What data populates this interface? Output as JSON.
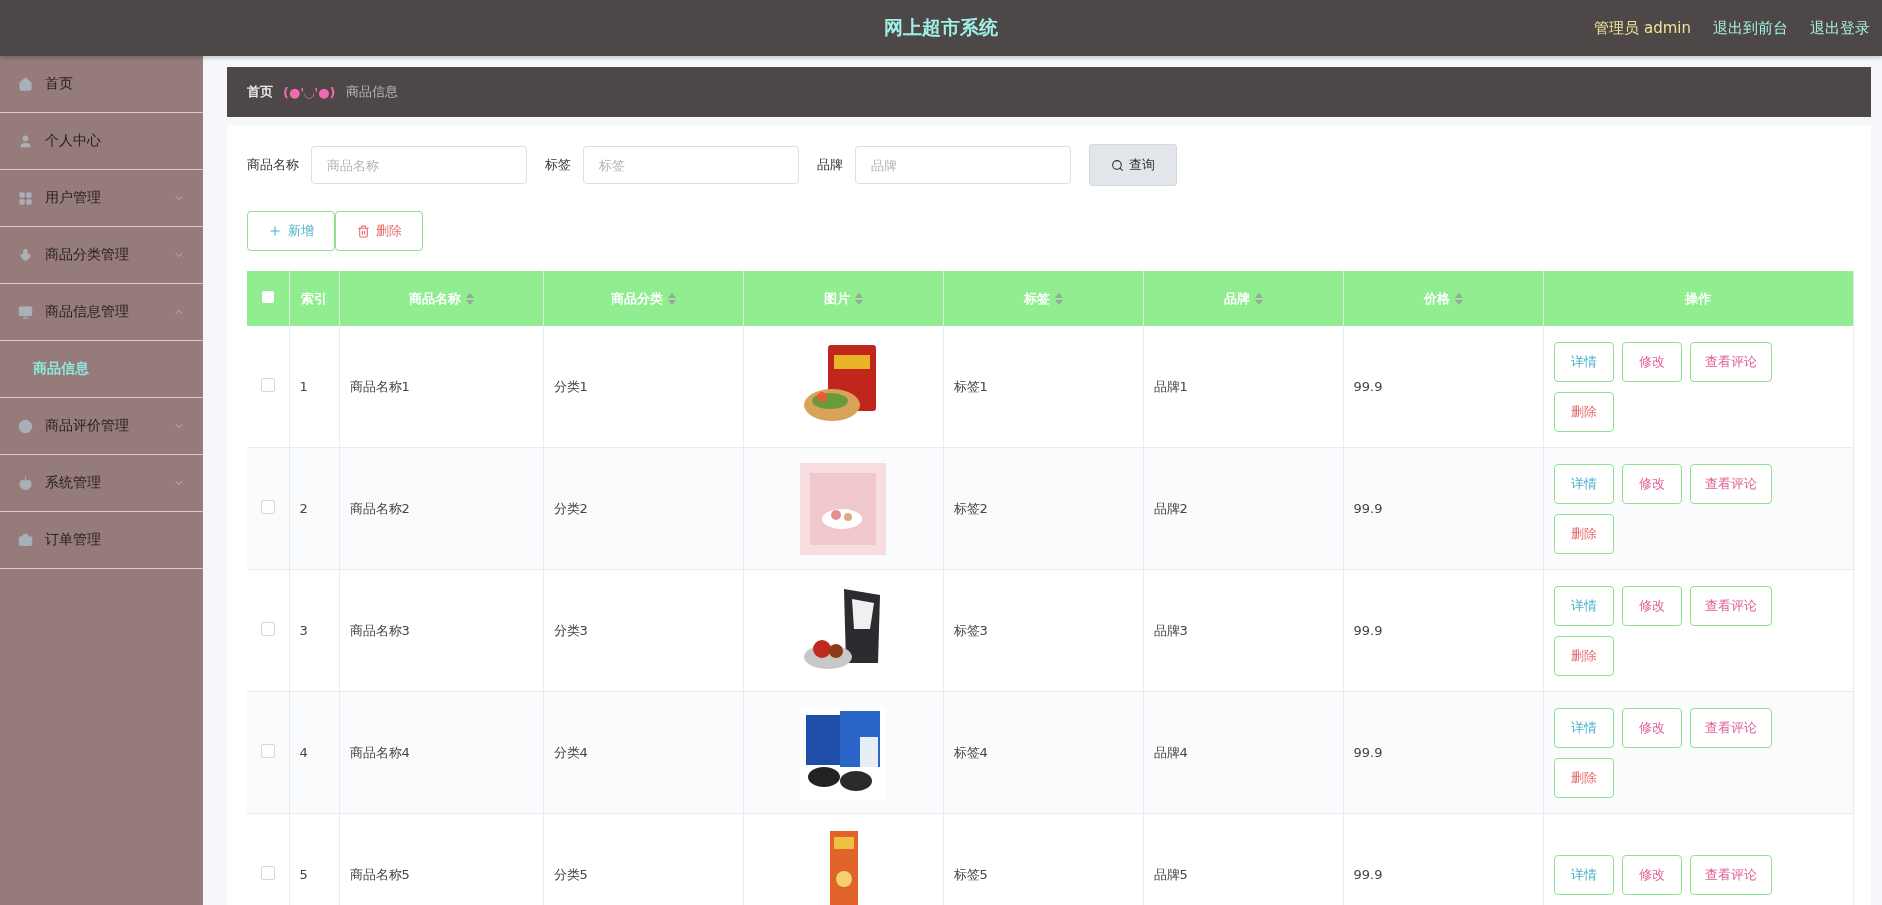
{
  "header": {
    "title": "网上超市系统",
    "user": "管理员 admin",
    "links": [
      "退出到前台",
      "退出登录"
    ]
  },
  "sidebar": {
    "items": [
      {
        "label": "首页",
        "selected": false
      },
      {
        "label": "个人中心",
        "selected": false
      },
      {
        "label": "用户管理",
        "selected": false,
        "expanded": false
      },
      {
        "label": "商品分类管理",
        "selected": false,
        "expanded": false
      },
      {
        "label": "商品信息管理",
        "selected": false,
        "expanded": true,
        "children": [
          {
            "label": "商品信息",
            "selected": true
          }
        ]
      },
      {
        "label": "商品评价管理",
        "selected": false,
        "expanded": false
      },
      {
        "label": "系统管理",
        "selected": false,
        "expanded": false
      },
      {
        "label": "订单管理",
        "selected": false
      }
    ]
  },
  "breadcrumb": {
    "home": "首页",
    "separator": "(●'◡'●)",
    "current": "商品信息"
  },
  "search": {
    "fields": [
      {
        "label": "商品名称",
        "placeholder": "商品名称"
      },
      {
        "label": "标签",
        "placeholder": "标签"
      },
      {
        "label": "品牌",
        "placeholder": "品牌"
      }
    ],
    "button": "查询"
  },
  "toolbar": [
    {
      "kind": "add",
      "label": "新增"
    },
    {
      "kind": "delete",
      "label": "删除"
    }
  ],
  "table": {
    "select_all": {
      "checked": false
    },
    "columns": [
      {
        "label": "索引",
        "sortable": false
      },
      {
        "label": "商品名称",
        "sortable": true
      },
      {
        "label": "商品分类",
        "sortable": true
      },
      {
        "label": "图片",
        "sortable": true
      },
      {
        "label": "标签",
        "sortable": true
      },
      {
        "label": "品牌",
        "sortable": true
      },
      {
        "label": "价格",
        "sortable": true
      },
      {
        "label": "操作",
        "sortable": false
      }
    ],
    "rows": [
      {
        "checked": false,
        "cells": [
          "1",
          "商品名称1",
          "分类1",
          {
            "kind": "picture"
          },
          "标签1",
          "品牌1",
          "99.9"
        ],
        "actions": [
          {
            "kind": "detail",
            "label": "详情"
          },
          {
            "kind": "edit",
            "label": "修改"
          },
          {
            "kind": "comments",
            "label": "查看评论"
          },
          {
            "kind": "delete",
            "label": "删除"
          }
        ]
      },
      {
        "checked": false,
        "cells": [
          "2",
          "商品名称2",
          "分类2",
          {
            "kind": "picture"
          },
          "标签2",
          "品牌2",
          "99.9"
        ],
        "actions": [
          {
            "kind": "detail",
            "label": "详情"
          },
          {
            "kind": "edit",
            "label": "修改"
          },
          {
            "kind": "comments",
            "label": "查看评论"
          },
          {
            "kind": "delete",
            "label": "删除"
          }
        ]
      },
      {
        "checked": false,
        "cells": [
          "3",
          "商品名称3",
          "分类3",
          {
            "kind": "picture"
          },
          "标签3",
          "品牌3",
          "99.9"
        ],
        "actions": [
          {
            "kind": "detail",
            "label": "详情"
          },
          {
            "kind": "edit",
            "label": "修改"
          },
          {
            "kind": "comments",
            "label": "查看评论"
          },
          {
            "kind": "delete",
            "label": "删除"
          }
        ]
      },
      {
        "checked": false,
        "cells": [
          "4",
          "商品名称4",
          "分类4",
          {
            "kind": "picture"
          },
          "标签4",
          "品牌4",
          "99.9"
        ],
        "actions": [
          {
            "kind": "detail",
            "label": "详情"
          },
          {
            "kind": "edit",
            "label": "修改"
          },
          {
            "kind": "comments",
            "label": "查看评论"
          },
          {
            "kind": "delete",
            "label": "删除"
          }
        ]
      },
      {
        "checked": false,
        "cells": [
          "5",
          "商品名称5",
          "分类5",
          {
            "kind": "picture"
          },
          "标签5",
          "品牌5",
          "99.9"
        ],
        "actions": [
          {
            "kind": "detail",
            "label": "详情"
          },
          {
            "kind": "edit",
            "label": "修改"
          },
          {
            "kind": "comments",
            "label": "查看评论"
          }
        ]
      }
    ]
  }
}
